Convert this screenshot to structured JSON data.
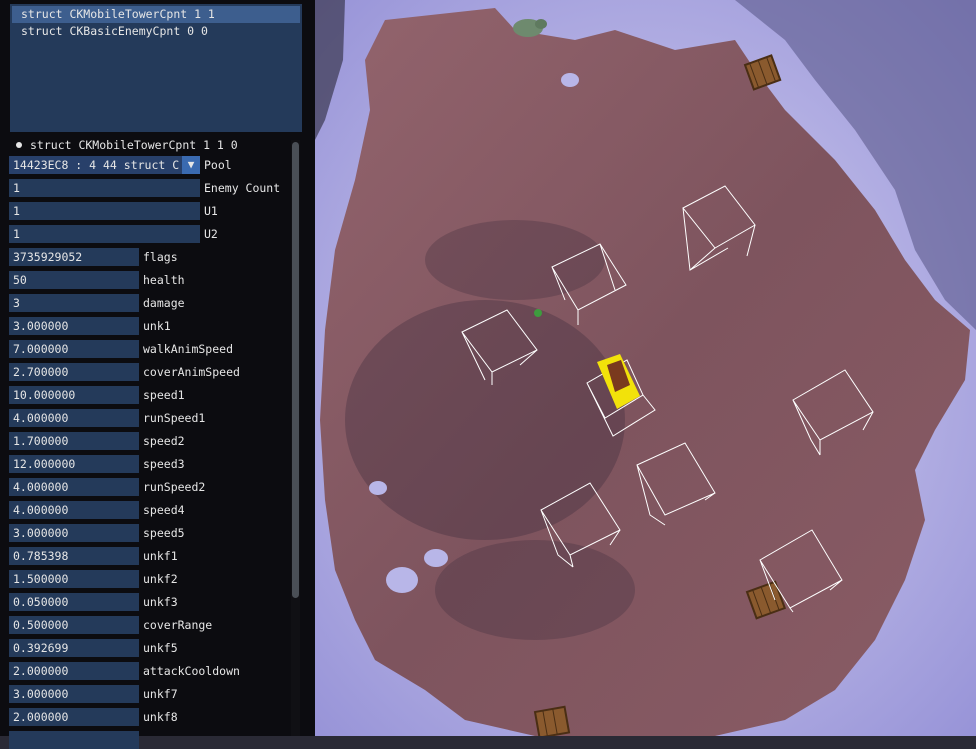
{
  "component_list": [
    {
      "label": "struct CKMobileTowerCpnt 1 1",
      "selected": true
    },
    {
      "label": "struct CKBasicEnemyCpnt 0 0",
      "selected": false
    }
  ],
  "section_header": "struct CKMobileTowerCpnt 1 1 0",
  "pool_combo": {
    "value": "14423EC8 : 4 44 struct C",
    "label": "Pool",
    "arrow": "▼"
  },
  "wide_fields": [
    {
      "value": "1",
      "label": "Enemy Count"
    },
    {
      "value": "1",
      "label": "U1"
    },
    {
      "value": "1",
      "label": "U2"
    }
  ],
  "fields": [
    {
      "value": "3735929052",
      "label": "flags"
    },
    {
      "value": "50",
      "label": "health"
    },
    {
      "value": "3",
      "label": "damage"
    },
    {
      "value": "3.000000",
      "label": "unk1"
    },
    {
      "value": "7.000000",
      "label": "walkAnimSpeed"
    },
    {
      "value": "2.700000",
      "label": "coverAnimSpeed"
    },
    {
      "value": "10.000000",
      "label": "speed1"
    },
    {
      "value": "4.000000",
      "label": "runSpeed1"
    },
    {
      "value": "1.700000",
      "label": "speed2"
    },
    {
      "value": "12.000000",
      "label": "speed3"
    },
    {
      "value": "4.000000",
      "label": "runSpeed2"
    },
    {
      "value": "4.000000",
      "label": "speed4"
    },
    {
      "value": "3.000000",
      "label": "speed5"
    },
    {
      "value": "0.785398",
      "label": "unkf1"
    },
    {
      "value": "1.500000",
      "label": "unkf2"
    },
    {
      "value": "0.050000",
      "label": "unkf3"
    },
    {
      "value": "0.500000",
      "label": "coverRange"
    },
    {
      "value": "0.392699",
      "label": "unkf5"
    },
    {
      "value": "2.000000",
      "label": "attackCooldown"
    },
    {
      "value": "3.000000",
      "label": "unkf7"
    },
    {
      "value": "2.000000",
      "label": "unkf8"
    },
    {
      "value": "",
      "label": ""
    }
  ],
  "colors": {
    "panel_bg": "#0a0a0e",
    "field_bg": "#243a5a",
    "list_selected": "#3d5e8e",
    "snow": "#c9c6ec",
    "ground": "#8c5e68",
    "highlight_box": "#f2e20a",
    "wireframe": "#ffffff"
  }
}
